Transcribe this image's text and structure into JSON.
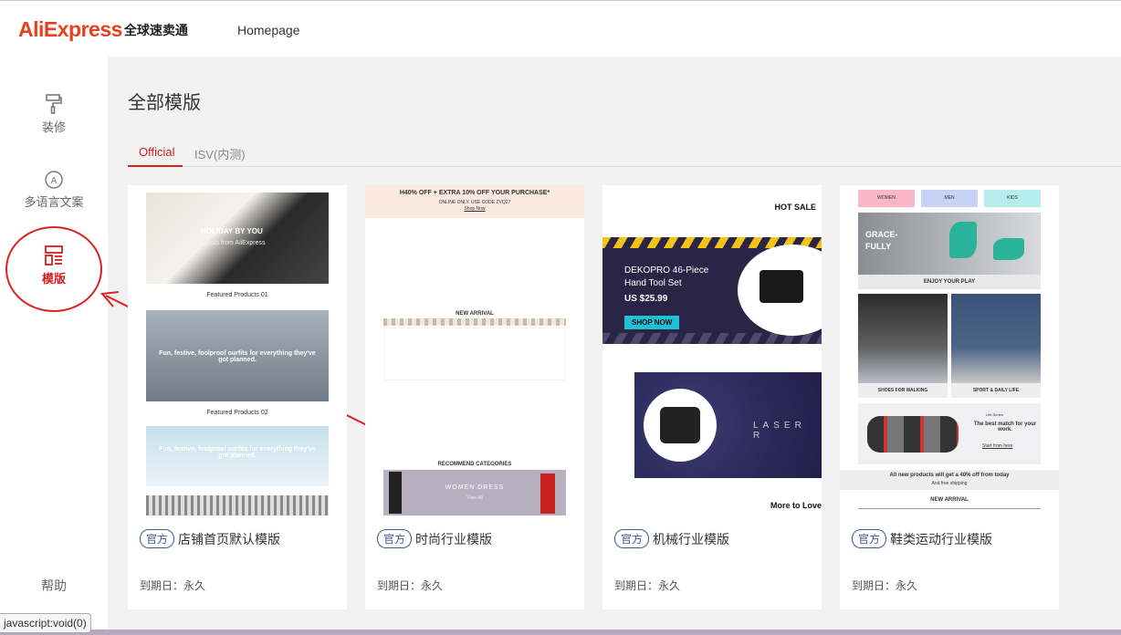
{
  "header": {
    "logo_text": "AliExpress",
    "logo_cn": "全球速卖通",
    "nav_home": "Homepage"
  },
  "sidebar": {
    "items": [
      {
        "label": "装修",
        "icon": "paint-roller-icon"
      },
      {
        "label": "多语言文案",
        "icon": "language-icon"
      },
      {
        "label": "模版",
        "icon": "template-icon",
        "active": true
      }
    ],
    "help": "帮助"
  },
  "main": {
    "title": "全部模版",
    "tabs": [
      {
        "label": "Official",
        "active": true
      },
      {
        "label": "ISV(内测)",
        "active": false
      }
    ]
  },
  "cards": [
    {
      "tag": "官方",
      "name": "店铺首页默认模版",
      "expire": "到期日：永久",
      "preview": {
        "banner_text": "HOLIDAY BY YOU",
        "banner_sub": "Deals from AliExpress",
        "featured1": "Featured Products 01",
        "img2_text": "Fun, festive, foolproof ourfits for everything they've got planned.",
        "featured2": "Featured Products 02",
        "img3_text": "Fun, festive, foolproof ourfits for everything they've got planned."
      }
    },
    {
      "tag": "官方",
      "name": "时尚行业模版",
      "expire": "到期日：永久",
      "preview": {
        "promo": "H40% OFF + EXTRA 10% OFF YOUR PURCHASE*",
        "promo_sub": "ONLINE ONLY. USE CODE ZVQ27",
        "shop_now": "Shop Now",
        "new_arrival": "NEW ARRIVAL",
        "recommend": "RECOMMEND CATEGORIES",
        "women_dress": "WOMEN DRESS",
        "view_all": "View All"
      }
    },
    {
      "tag": "官方",
      "name": "机械行业模版",
      "expire": "到期日：永久",
      "preview": {
        "hot_sale": "HOT SALE",
        "product": "DEKOPRO 46-Piece Hand Tool Set",
        "price": "US $25.99",
        "shop_now": "SHOP NOW",
        "laser": "LASER R",
        "more": "More to Love"
      }
    },
    {
      "tag": "官方",
      "name": "鞋类运动行业模版",
      "expire": "到期日：永久",
      "preview": {
        "tabs": [
          "WOMEN",
          "MEN",
          "KIDS"
        ],
        "grace": "GRACE-FULLY",
        "enjoy": "ENJOY YOUR PLAY",
        "walking": "SHOES FOR WALKING",
        "sport": "SPORT & DAILY LIFE",
        "life_series": "Life Series",
        "best_match": "The best match for your work.",
        "start": "Start from here",
        "discount": "All new products will get a 40% off from today",
        "free_ship": "And free shipping",
        "new_arrival": "NEW ARRIVAL"
      }
    }
  ],
  "status_bar": "javascript:void(0)"
}
